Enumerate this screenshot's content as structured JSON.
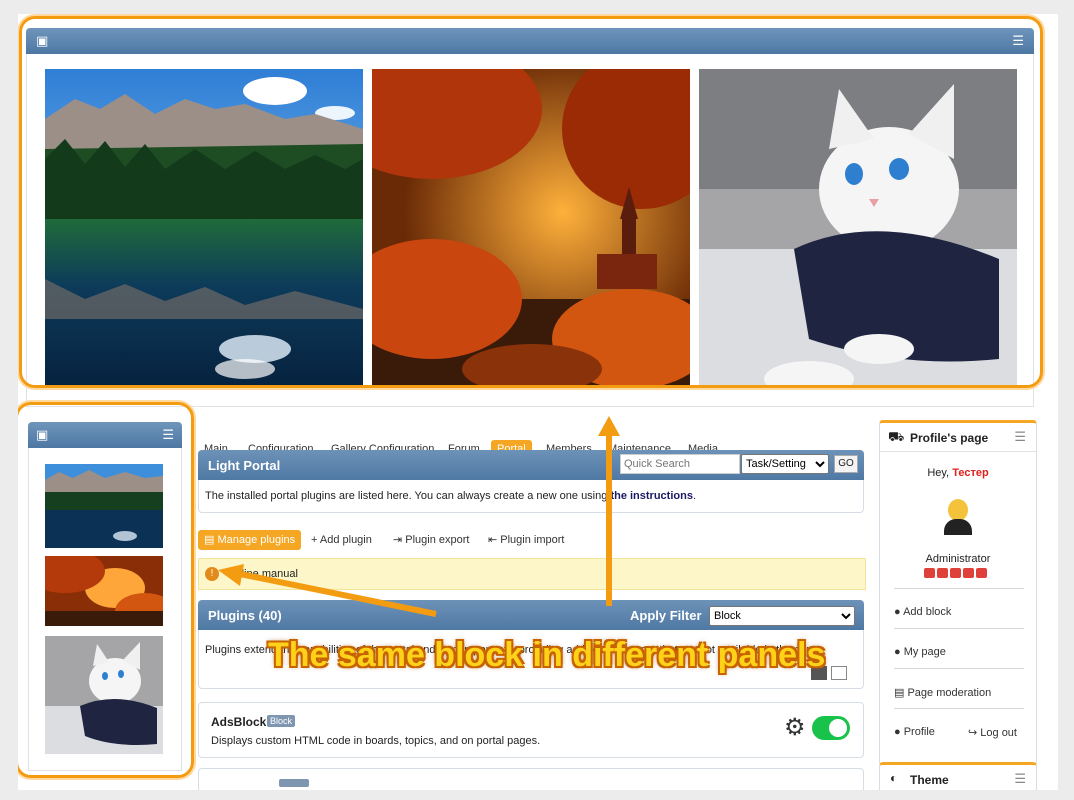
{
  "tabs": [
    "Main",
    "Configuration",
    "Gallery Configuration",
    "Forum",
    "Portal",
    "Members",
    "Maintenance",
    "Media"
  ],
  "active_tab": "Portal",
  "light_portal": {
    "title": "Light Portal",
    "description": "The installed portal plugins are listed here. You can always create a new one using",
    "link": "the instructions",
    "link_suffix": "."
  },
  "search": {
    "placeholder": "Quick Search",
    "select": "Task/Setting",
    "go": "GO"
  },
  "actions": {
    "manage": "Manage plugins",
    "add": "Add plugin",
    "export": "Plugin export",
    "import": "Plugin import"
  },
  "notice": "Online manual",
  "plugins": {
    "title": "Plugins (40)",
    "filter_label": "Apply Filter",
    "filter_value": "Block",
    "description": "Plugins extend the capabilities of the portal and its components, providing additional features that are not available in the core."
  },
  "adsblock": {
    "name": "AdsBlock",
    "badge": "Block",
    "description": "Displays custom HTML code in boards, topics, and on portal pages."
  },
  "profile": {
    "header": "Profile's page",
    "greeting": "Hey,",
    "username": "Тестер",
    "role": "Administrator",
    "links": [
      "Add block",
      "My page",
      "Page moderation"
    ],
    "profile": "Profile",
    "logout": "Log out"
  },
  "theme": {
    "header": "Theme"
  },
  "caption": "The same block in different panels",
  "icons": {
    "image": "image-icon",
    "settings": "sliders-icon",
    "car": "car-icon",
    "gear": "gear-icon"
  },
  "colors": {
    "accent": "#f5a623",
    "header_blue": "#5a82ad",
    "toggle_green": "#19c24a",
    "highlight_orange": "#f39c12",
    "username_red": "#e0201b"
  }
}
